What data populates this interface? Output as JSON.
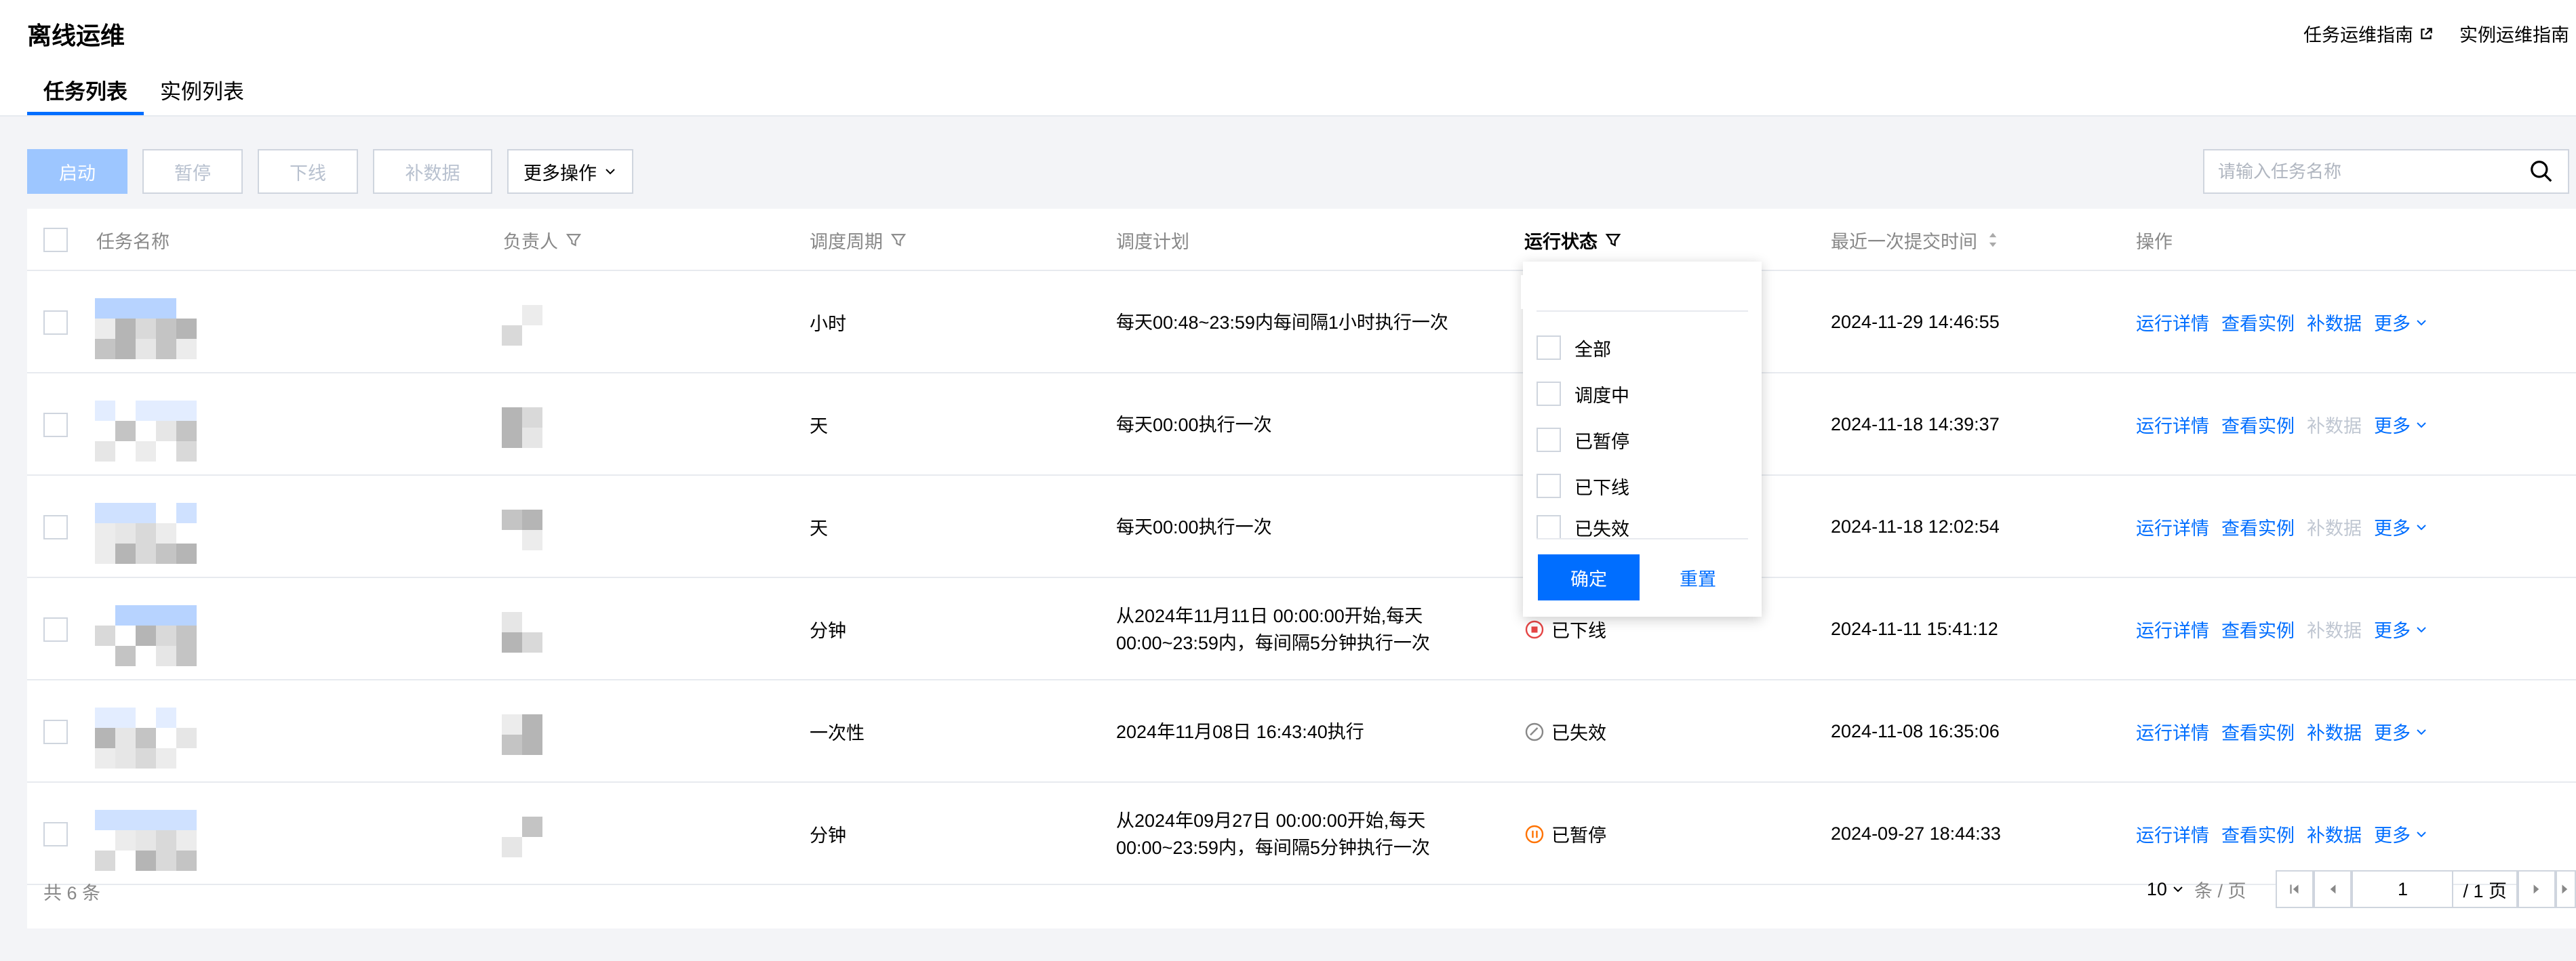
{
  "header": {
    "title": "离线运维",
    "guides": [
      {
        "label": "任务运维指南",
        "icon": "external-link-icon"
      },
      {
        "label": "实例运维指南"
      }
    ],
    "tabs": [
      {
        "label": "任务列表",
        "active": true
      },
      {
        "label": "实例列表",
        "active": false
      }
    ]
  },
  "toolbar": {
    "buttons": [
      "启动",
      "暂停",
      "下线",
      "补数据"
    ],
    "more_label": "更多操作",
    "search_placeholder": "请输入任务名称"
  },
  "table": {
    "columns": [
      {
        "label": "任务名称"
      },
      {
        "label": "负责人",
        "icon": "filter-icon"
      },
      {
        "label": "调度周期",
        "icon": "filter-icon"
      },
      {
        "label": "调度计划"
      },
      {
        "label": "运行状态",
        "icon": "filter-icon"
      },
      {
        "label": "最近一次提交时间",
        "icon": "sort-icon"
      },
      {
        "label": "操作"
      }
    ],
    "rows": [
      {
        "cycle": "小时",
        "plan": [
          "每天00:48~23:59内每间隔1小时执行一次"
        ],
        "status": "",
        "status_icon": "",
        "time": "2024-11-29 14:46:55",
        "backfill_enabled": true
      },
      {
        "cycle": "天",
        "plan": [
          "每天00:00执行一次"
        ],
        "status": "",
        "status_icon": "",
        "time": "2024-11-18 14:39:37",
        "backfill_enabled": false
      },
      {
        "cycle": "天",
        "plan": [
          "每天00:00执行一次"
        ],
        "status": "",
        "status_icon": "",
        "time": "2024-11-18 12:02:54",
        "backfill_enabled": false
      },
      {
        "cycle": "分钟",
        "plan": [
          "从2024年11月11日 00:00:00开始,每天",
          "00:00~23:59内，每间隔5分钟执行一次"
        ],
        "status": "已下线",
        "status_icon": "offline-icon",
        "time": "2024-11-11 15:41:12",
        "backfill_enabled": false
      },
      {
        "cycle": "一次性",
        "plan": [
          "2024年11月08日 16:43:40执行"
        ],
        "status": "已失效",
        "status_icon": "expired-icon",
        "time": "2024-11-08 16:35:06",
        "backfill_enabled": true
      },
      {
        "cycle": "分钟",
        "plan": [
          "从2024年09月27日 00:00:00开始,每天",
          "00:00~23:59内，每间隔5分钟执行一次"
        ],
        "status": "已暂停",
        "status_icon": "paused-icon",
        "time": "2024-09-27 18:44:33",
        "backfill_enabled": true
      }
    ],
    "row_actions": {
      "details": "运行详情",
      "instances": "查看实例",
      "backfill": "补数据",
      "more": "更多"
    }
  },
  "status_filter": {
    "options": [
      "全部",
      "调度中",
      "已暂停",
      "已下线",
      "已失效"
    ],
    "confirm": "确定",
    "reset": "重置"
  },
  "footer": {
    "total": "共 6 条",
    "page_size": "10",
    "page_size_unit": "条 / 页",
    "current_page": "1",
    "total_pages": "/ 1 页"
  },
  "colors": {
    "accent": "#006eff",
    "disabled_primary": "#9dc6ff",
    "offline": "#e54545",
    "paused": "#ff7200",
    "expired": "#888888"
  }
}
